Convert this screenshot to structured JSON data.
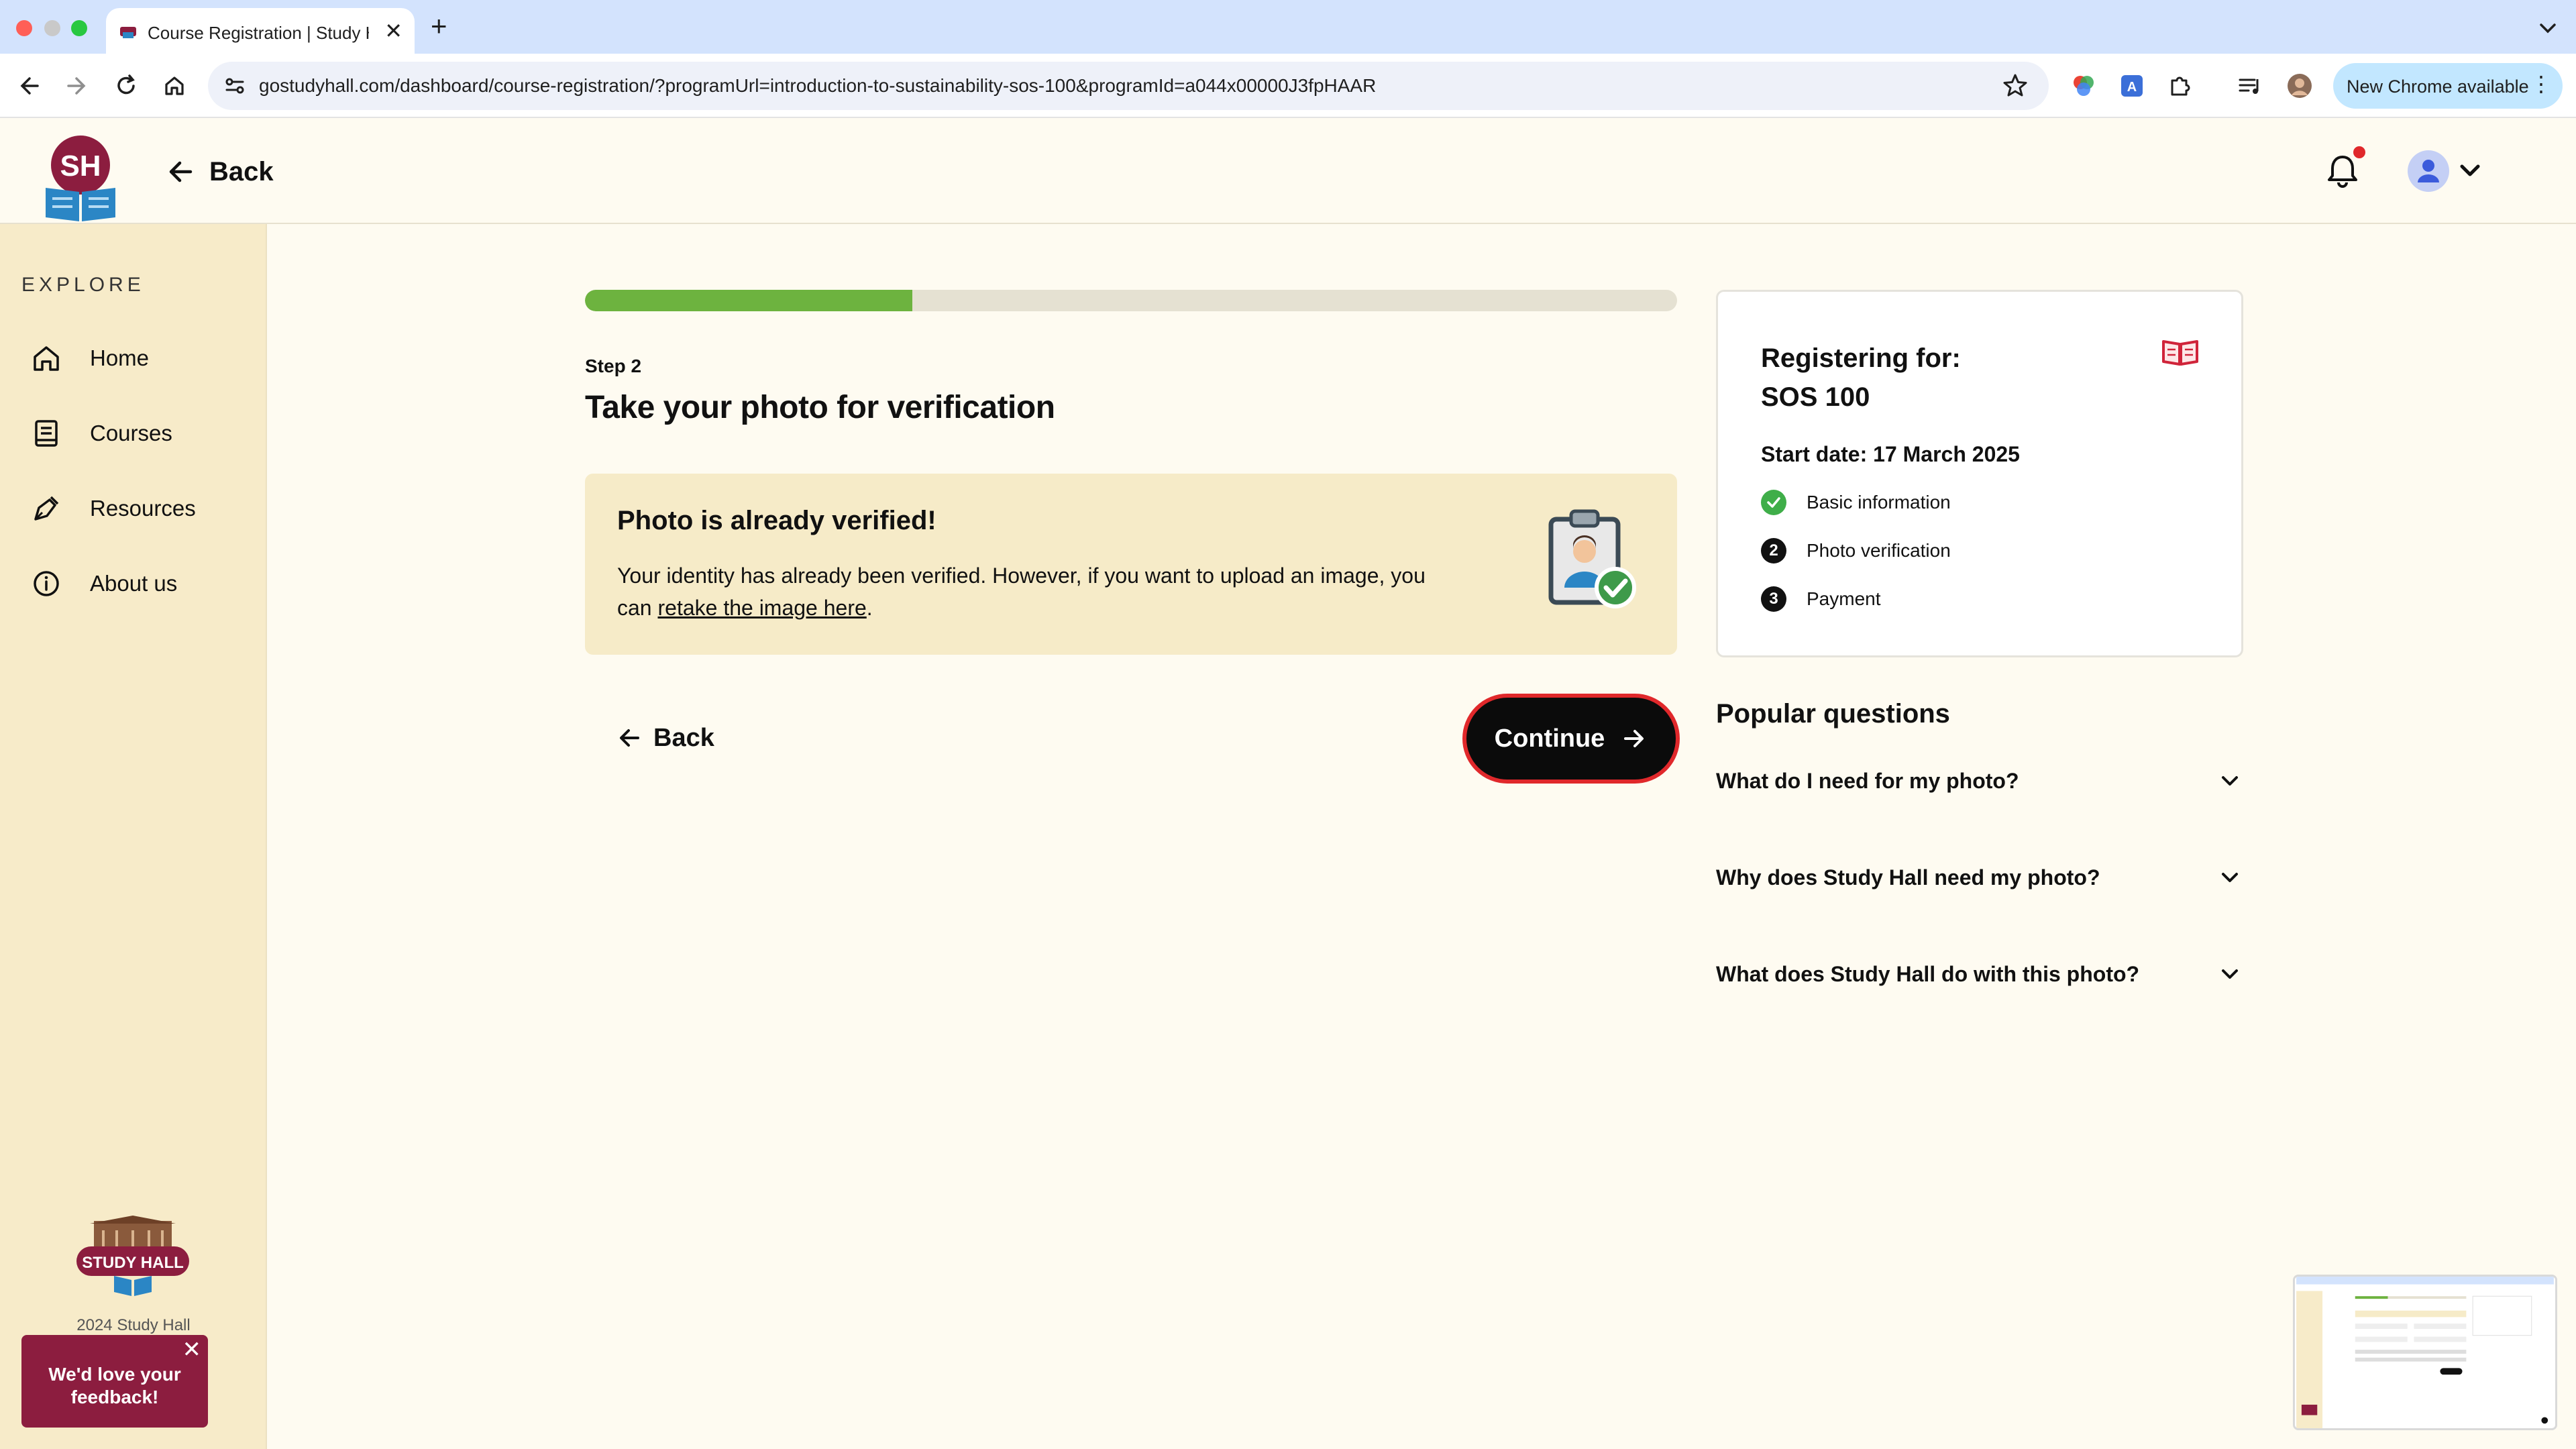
{
  "browser": {
    "tab_title": "Course Registration | Study Hall",
    "url": "gostudyhall.com/dashboard/course-registration/?programUrl=introduction-to-sustainability-sos-100&programId=a044x00000J3fpHAAR",
    "new_chrome_label": "New Chrome available"
  },
  "header": {
    "logo_text": "SH",
    "back_label": "Back"
  },
  "sidebar": {
    "section_label": "EXPLORE",
    "items": [
      {
        "label": "Home",
        "icon": "home-icon"
      },
      {
        "label": "Courses",
        "icon": "courses-icon"
      },
      {
        "label": "Resources",
        "icon": "resources-icon"
      },
      {
        "label": "About us",
        "icon": "info-icon"
      }
    ],
    "footer_logo_text": "STUDY HALL",
    "copyright": "2024 Study Hall",
    "feedback_label": "We'd love your feedback!"
  },
  "main": {
    "progress_fraction": 0.3,
    "step_label": "Step 2",
    "title": "Take your photo for verification",
    "verified_card": {
      "title": "Photo is already verified!",
      "body_before_link": "Your identity has already been verified. However, if you want to upload an image, you can ",
      "link_text": "retake the image here",
      "body_after_link": "."
    },
    "back_label": "Back",
    "continue_label": "Continue"
  },
  "registration": {
    "title_line1": "Registering for:",
    "title_line2": "SOS 100",
    "start_date": "Start date: 17 March 2025",
    "steps": [
      {
        "label": "Basic information",
        "status": "done"
      },
      {
        "label": "Photo verification",
        "number": "2",
        "status": "current"
      },
      {
        "label": "Payment",
        "number": "3",
        "status": "todo"
      }
    ]
  },
  "popular_questions": {
    "title": "Popular questions",
    "items": [
      "What do I need for my photo?",
      "Why does Study Hall need my photo?",
      "What does Study Hall do with this photo?"
    ]
  },
  "colors": {
    "brand": "#8c1d3f",
    "progress": "#6db33f",
    "accent_red": "#e0282b",
    "sidebar_bg": "#f7ebc9",
    "page_bg": "#fefbf1"
  }
}
